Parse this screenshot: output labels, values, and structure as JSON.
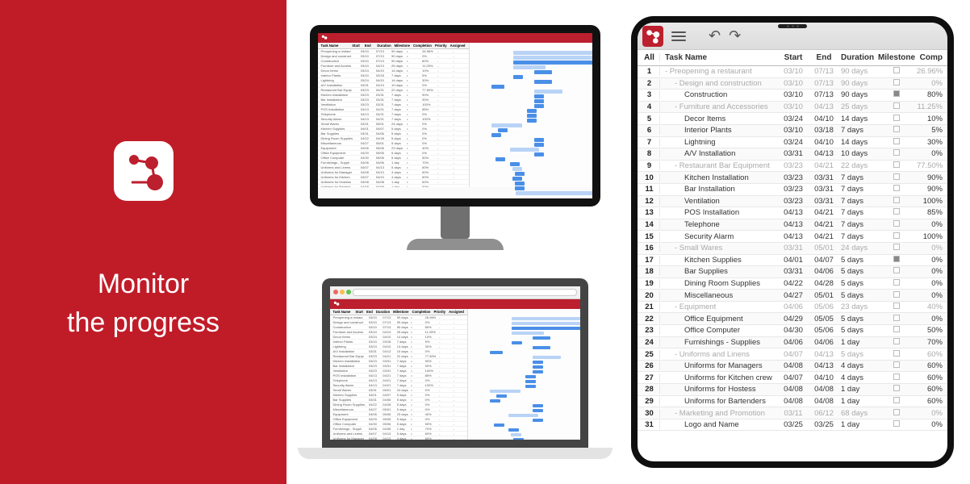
{
  "left": {
    "line1": "Monitor",
    "line2": "the progress"
  },
  "mini_columns": {
    "name": "Task Name",
    "start": "Start",
    "end": "End",
    "duration": "Duration",
    "milestone": "Milestone",
    "completion": "Completion",
    "priority": "Priority",
    "assigned": "Assigned"
  },
  "tablet": {
    "header": {
      "all": "All",
      "name": "Task Name",
      "start": "Start",
      "end": "End",
      "duration": "Duration",
      "milestone": "Milestone",
      "completion": "Comp"
    },
    "rows": [
      {
        "n": 1,
        "name": "Preopening a restaurant",
        "start": "03/10",
        "end": "07/13",
        "dur": "90 days",
        "mile": false,
        "comp": "26.96%",
        "indent": 1,
        "summary": true,
        "prefix": "- "
      },
      {
        "n": 2,
        "name": "Design and construction",
        "start": "03/10",
        "end": "07/13",
        "dur": "90 days",
        "mile": false,
        "comp": "0%",
        "indent": 2,
        "summary": true,
        "prefix": "- "
      },
      {
        "n": 3,
        "name": "Construction",
        "start": "03/10",
        "end": "07/13",
        "dur": "90 days",
        "mile": true,
        "comp": "80%",
        "indent": 3,
        "summary": false,
        "prefix": ""
      },
      {
        "n": 4,
        "name": "Furniture and Accessories",
        "start": "03/10",
        "end": "04/13",
        "dur": "25 days",
        "mile": false,
        "comp": "11.25%",
        "indent": 2,
        "summary": true,
        "prefix": "- "
      },
      {
        "n": 5,
        "name": "Decor Items",
        "start": "03/24",
        "end": "04/10",
        "dur": "14 days",
        "mile": false,
        "comp": "10%",
        "indent": 3,
        "summary": false,
        "prefix": ""
      },
      {
        "n": 6,
        "name": "Interior Plants",
        "start": "03/10",
        "end": "03/18",
        "dur": "7 days",
        "mile": false,
        "comp": "5%",
        "indent": 3,
        "summary": false,
        "prefix": ""
      },
      {
        "n": 7,
        "name": "Lightning",
        "start": "03/24",
        "end": "04/10",
        "dur": "14 days",
        "mile": false,
        "comp": "30%",
        "indent": 3,
        "summary": false,
        "prefix": ""
      },
      {
        "n": 8,
        "name": "A/V Installation",
        "start": "03/31",
        "end": "04/13",
        "dur": "10 days",
        "mile": false,
        "comp": "0%",
        "indent": 3,
        "summary": false,
        "prefix": ""
      },
      {
        "n": 9,
        "name": "Restaurant Bar Equipment",
        "start": "03/23",
        "end": "04/21",
        "dur": "22 days",
        "mile": false,
        "comp": "77.50%",
        "indent": 2,
        "summary": true,
        "prefix": "- "
      },
      {
        "n": 10,
        "name": "Kitchen Installation",
        "start": "03/23",
        "end": "03/31",
        "dur": "7 days",
        "mile": false,
        "comp": "90%",
        "indent": 3,
        "summary": false,
        "prefix": ""
      },
      {
        "n": 11,
        "name": "Bar Installation",
        "start": "03/23",
        "end": "03/31",
        "dur": "7 days",
        "mile": false,
        "comp": "90%",
        "indent": 3,
        "summary": false,
        "prefix": ""
      },
      {
        "n": 12,
        "name": "Ventilation",
        "start": "03/23",
        "end": "03/31",
        "dur": "7 days",
        "mile": false,
        "comp": "100%",
        "indent": 3,
        "summary": false,
        "prefix": ""
      },
      {
        "n": 13,
        "name": "POS Installation",
        "start": "04/13",
        "end": "04/21",
        "dur": "7 days",
        "mile": false,
        "comp": "85%",
        "indent": 3,
        "summary": false,
        "prefix": ""
      },
      {
        "n": 14,
        "name": "Telephone",
        "start": "04/13",
        "end": "04/21",
        "dur": "7 days",
        "mile": false,
        "comp": "0%",
        "indent": 3,
        "summary": false,
        "prefix": ""
      },
      {
        "n": 15,
        "name": "Security Alarm",
        "start": "04/13",
        "end": "04/21",
        "dur": "7 days",
        "mile": false,
        "comp": "100%",
        "indent": 3,
        "summary": false,
        "prefix": ""
      },
      {
        "n": 16,
        "name": "Small Wares",
        "start": "03/31",
        "end": "05/01",
        "dur": "24 days",
        "mile": false,
        "comp": "0%",
        "indent": 2,
        "summary": true,
        "prefix": "- "
      },
      {
        "n": 17,
        "name": "Kitchen Supplies",
        "start": "04/01",
        "end": "04/07",
        "dur": "5 days",
        "mile": true,
        "comp": "0%",
        "indent": 3,
        "summary": false,
        "prefix": ""
      },
      {
        "n": 18,
        "name": "Bar Supplies",
        "start": "03/31",
        "end": "04/06",
        "dur": "5 days",
        "mile": false,
        "comp": "0%",
        "indent": 3,
        "summary": false,
        "prefix": ""
      },
      {
        "n": 19,
        "name": "Dining Room Supplies",
        "start": "04/22",
        "end": "04/28",
        "dur": "5 days",
        "mile": false,
        "comp": "0%",
        "indent": 3,
        "summary": false,
        "prefix": ""
      },
      {
        "n": 20,
        "name": "Miscellaneous",
        "start": "04/27",
        "end": "05/01",
        "dur": "5 days",
        "mile": false,
        "comp": "0%",
        "indent": 3,
        "summary": false,
        "prefix": ""
      },
      {
        "n": 21,
        "name": "Equipment",
        "start": "04/06",
        "end": "05/06",
        "dur": "23 days",
        "mile": false,
        "comp": "40%",
        "indent": 2,
        "summary": true,
        "prefix": "- "
      },
      {
        "n": 22,
        "name": "Office Equipment",
        "start": "04/29",
        "end": "05/05",
        "dur": "5 days",
        "mile": false,
        "comp": "0%",
        "indent": 3,
        "summary": false,
        "prefix": ""
      },
      {
        "n": 23,
        "name": "Office Computer",
        "start": "04/30",
        "end": "05/06",
        "dur": "5 days",
        "mile": false,
        "comp": "50%",
        "indent": 3,
        "summary": false,
        "prefix": ""
      },
      {
        "n": 24,
        "name": "Furnishings - Supplies",
        "start": "04/06",
        "end": "04/06",
        "dur": "1 day",
        "mile": false,
        "comp": "70%",
        "indent": 3,
        "summary": false,
        "prefix": ""
      },
      {
        "n": 25,
        "name": "Uniforms and Linens",
        "start": "04/07",
        "end": "04/13",
        "dur": "5 days",
        "mile": false,
        "comp": "60%",
        "indent": 2,
        "summary": true,
        "prefix": "- "
      },
      {
        "n": 26,
        "name": "Uniforms for Managers",
        "start": "04/08",
        "end": "04/13",
        "dur": "4 days",
        "mile": false,
        "comp": "60%",
        "indent": 3,
        "summary": false,
        "prefix": ""
      },
      {
        "n": 27,
        "name": "Uniforms for Kitchen crew",
        "start": "04/07",
        "end": "04/10",
        "dur": "4 days",
        "mile": false,
        "comp": "60%",
        "indent": 3,
        "summary": false,
        "prefix": ""
      },
      {
        "n": 28,
        "name": "Uniforms for Hostess",
        "start": "04/08",
        "end": "04/08",
        "dur": "1 day",
        "mile": false,
        "comp": "60%",
        "indent": 3,
        "summary": false,
        "prefix": ""
      },
      {
        "n": 29,
        "name": "Uniforms for Bartenders",
        "start": "04/08",
        "end": "04/08",
        "dur": "1 day",
        "mile": false,
        "comp": "60%",
        "indent": 3,
        "summary": false,
        "prefix": ""
      },
      {
        "n": 30,
        "name": "Marketing and Promotion",
        "start": "03/11",
        "end": "06/12",
        "dur": "68 days",
        "mile": false,
        "comp": "0%",
        "indent": 2,
        "summary": true,
        "prefix": "- "
      },
      {
        "n": 31,
        "name": "Logo and Name",
        "start": "03/25",
        "end": "03/25",
        "dur": "1 day",
        "mile": false,
        "comp": "0%",
        "indent": 3,
        "summary": false,
        "prefix": ""
      }
    ]
  }
}
